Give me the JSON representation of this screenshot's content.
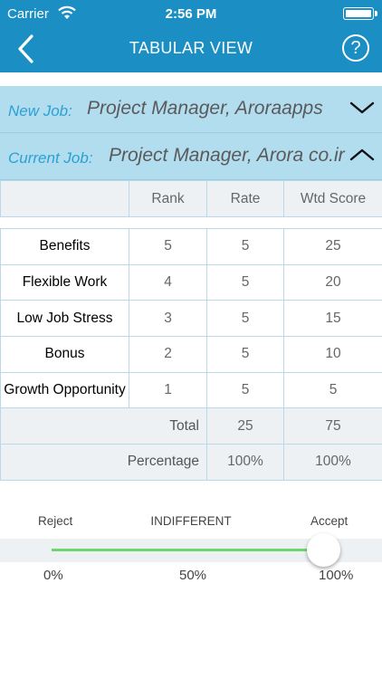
{
  "status_bar": {
    "carrier": "Carrier",
    "time": "2:56 PM"
  },
  "nav": {
    "title": "TABULAR VIEW",
    "help_label": "?",
    "back_icon": "chevron-left-icon"
  },
  "new_job": {
    "label": "New Job:",
    "value": "Project Manager, Aroraapps",
    "state": "collapsed"
  },
  "current_job": {
    "label": "Current Job:",
    "value": "Project Manager, Arora co.ir",
    "state": "expanded"
  },
  "table": {
    "headers": [
      "",
      "Rank",
      "Rate",
      "Wtd Score"
    ],
    "rows": [
      {
        "metric": "Benefits",
        "rank": "5",
        "rate": "5",
        "wtd": "25"
      },
      {
        "metric": "Flexible Work",
        "rank": "4",
        "rate": "5",
        "wtd": "20"
      },
      {
        "metric": "Low Job Stress",
        "rank": "3",
        "rate": "5",
        "wtd": "15"
      },
      {
        "metric": "Bonus",
        "rank": "2",
        "rate": "5",
        "wtd": "10"
      },
      {
        "metric": "Growth Opportunity",
        "rank": "1",
        "rate": "5",
        "wtd": "5"
      }
    ],
    "total": {
      "label": "Total",
      "rate": "25",
      "wtd": "75"
    },
    "percentage": {
      "label": "Percentage",
      "rate": "100%",
      "wtd": "100%"
    }
  },
  "slider": {
    "left_label": "Reject",
    "center_label": "INDIFFERENT",
    "right_label": "Accept",
    "min_label": "0%",
    "mid_label": "50%",
    "max_label": "100%",
    "value_fraction": 1.0
  },
  "colors": {
    "header": "#1b8fc4",
    "job_row": "#b2ddef",
    "accent": "#2aa0d6",
    "slider_track": "#6bd86b"
  }
}
